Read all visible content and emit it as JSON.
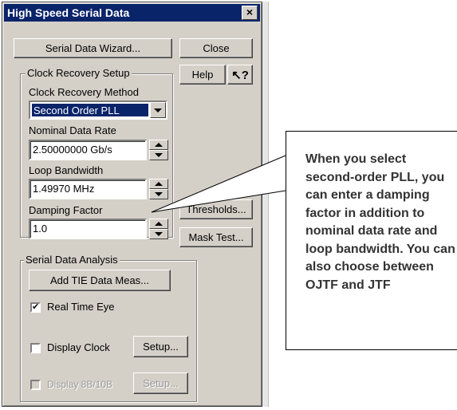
{
  "dialog": {
    "title": "High Speed Serial Data",
    "close_x": "×",
    "wizard_button": "Serial Data Wizard...",
    "close_button": "Close",
    "help_button": "Help",
    "help_cursor_glyph": "↖?",
    "thresholds_button": "Thresholds...",
    "mask_test_button": "Mask Test..."
  },
  "clock_recovery": {
    "group_label": "Clock Recovery Setup",
    "method_label": "Clock Recovery Method",
    "method_value": "Second Order PLL",
    "nominal_rate_label": "Nominal Data Rate",
    "nominal_rate_value": "2.50000000 Gb/s",
    "loop_bw_label": "Loop Bandwidth",
    "loop_bw_value": "1.49970 MHz",
    "damping_label": "Damping Factor",
    "damping_value": "1.0"
  },
  "serial_analysis": {
    "group_label": "Serial Data Analysis",
    "add_tie_button": "Add TIE Data Meas...",
    "real_time_eye_label": "Real Time Eye",
    "real_time_eye_checked": true,
    "display_clock_label": "Display Clock",
    "display_clock_checked": false,
    "display_clock_setup": "Setup...",
    "display_8b10b_label": "Display 8B/10B",
    "display_8b10b_setup": "Setup..."
  },
  "callout": {
    "text": "When you select second-order PLL, you can enter a damping factor in addition to nominal data rate and loop bandwidth. You can also choose between OJTF and JTF"
  },
  "icons": [
    "close-icon",
    "help-cursor-icon",
    "dropdown-arrow-icon",
    "spin-up-icon",
    "spin-down-icon",
    "checkmark-icon"
  ]
}
